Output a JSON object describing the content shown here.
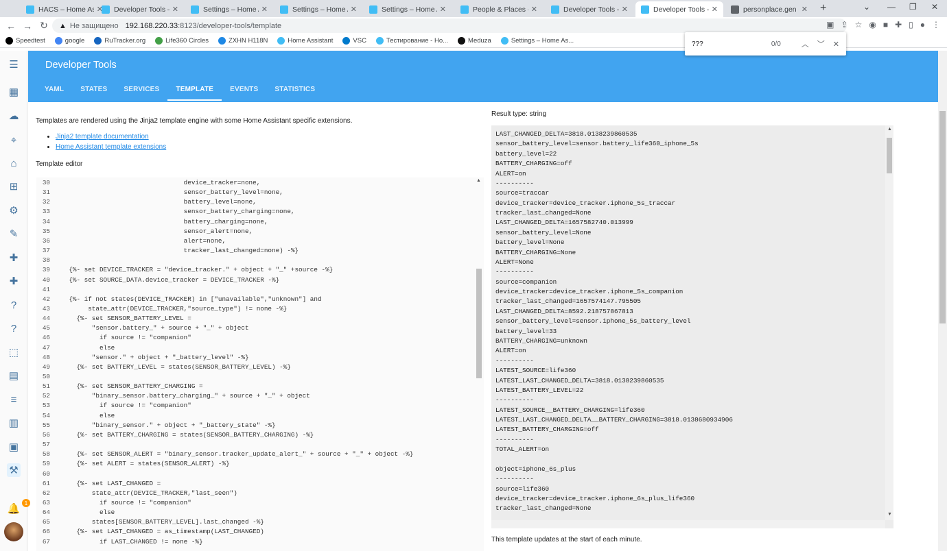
{
  "browser": {
    "tabs": [
      {
        "title": "HACS – Home Assistant",
        "active": false
      },
      {
        "title": "Developer Tools – Home",
        "active": false
      },
      {
        "title": "Settings – Home Assist",
        "active": false
      },
      {
        "title": "Settings – Home Assist",
        "active": false
      },
      {
        "title": "Settings – Home Assist",
        "active": false
      },
      {
        "title": "People & Places – Hom",
        "active": false
      },
      {
        "title": "Developer Tools – Hom",
        "active": false
      },
      {
        "title": "Developer Tools – Hom",
        "active": true
      },
      {
        "title": "personplace.gen - wor",
        "active": false
      }
    ],
    "insecure_label": "Не защищено",
    "url_host": "192.168.220.33",
    "url_path": ":8123/developer-tools/template",
    "bookmarks": [
      "Speedtest",
      "google",
      "RuTracker.org",
      "Life360 Circles",
      "ZXHN H118N",
      "Home Assistant",
      "VSC",
      "Тестирование - Но...",
      "Meduza",
      "Settings – Home As..."
    ],
    "find": {
      "query": "???",
      "count": "0/0"
    }
  },
  "header": {
    "title": "Developer Tools",
    "tabs": [
      "YAML",
      "STATES",
      "SERVICES",
      "TEMPLATE",
      "EVENTS",
      "STATISTICS"
    ],
    "selected_tab": "TEMPLATE"
  },
  "sidebar": {
    "notification_count": "1"
  },
  "main": {
    "intro": "Templates are rendered using the Jinja2 template engine with some Home Assistant specific extensions.",
    "links": [
      "Jinja2 template documentation",
      "Home Assistant template extensions"
    ],
    "editor_label": "Template editor",
    "result_type": "Result type: string",
    "footer": "This template updates at the start of each minute."
  },
  "editor_lines": [
    {
      "n": "30",
      "t": "                                  device_tracker=none,"
    },
    {
      "n": "31",
      "t": "                                  sensor_battery_level=none,"
    },
    {
      "n": "32",
      "t": "                                  battery_level=none,"
    },
    {
      "n": "33",
      "t": "                                  sensor_battery_charging=none,"
    },
    {
      "n": "34",
      "t": "                                  battery_charging=none,"
    },
    {
      "n": "35",
      "t": "                                  sensor_alert=none,"
    },
    {
      "n": "36",
      "t": "                                  alert=none,"
    },
    {
      "n": "37",
      "t": "                                  tracker_last_changed=none) -%}"
    },
    {
      "n": "38",
      "t": ""
    },
    {
      "n": "39",
      "t": "    {%- set DEVICE_TRACKER = \"device_tracker.\" + object + \"_\" +source -%}"
    },
    {
      "n": "40",
      "t": "    {%- set SOURCE_DATA.device_tracker = DEVICE_TRACKER -%}"
    },
    {
      "n": "41",
      "t": ""
    },
    {
      "n": "42",
      "t": "    {%- if not states(DEVICE_TRACKER) in [\"unavailable\",\"unknown\"] and"
    },
    {
      "n": "43",
      "t": "         state_attr(DEVICE_TRACKER,\"source_type\") != none -%}"
    },
    {
      "n": "44",
      "t": "      {%- set SENSOR_BATTERY_LEVEL ="
    },
    {
      "n": "45",
      "t": "          \"sensor.battery_\" + source + \"_\" + object"
    },
    {
      "n": "46",
      "t": "            if source != \"companion\""
    },
    {
      "n": "47",
      "t": "            else"
    },
    {
      "n": "48",
      "t": "          \"sensor.\" + object + \"_battery_level\" -%}"
    },
    {
      "n": "49",
      "t": "      {%- set BATTERY_LEVEL = states(SENSOR_BATTERY_LEVEL) -%}"
    },
    {
      "n": "50",
      "t": ""
    },
    {
      "n": "51",
      "t": "      {%- set SENSOR_BATTERY_CHARGING ="
    },
    {
      "n": "52",
      "t": "          \"binary_sensor.battery_charging_\" + source + \"_\" + object"
    },
    {
      "n": "53",
      "t": "            if source != \"companion\""
    },
    {
      "n": "54",
      "t": "            else"
    },
    {
      "n": "55",
      "t": "          \"binary_sensor.\" + object + \"_battery_state\" -%}"
    },
    {
      "n": "56",
      "t": "      {%- set BATTERY_CHARGING = states(SENSOR_BATTERY_CHARGING) -%}"
    },
    {
      "n": "57",
      "t": ""
    },
    {
      "n": "58",
      "t": "      {%- set SENSOR_ALERT = \"binary_sensor.tracker_update_alert_\" + source + \"_\" + object -%}"
    },
    {
      "n": "59",
      "t": "      {%- set ALERT = states(SENSOR_ALERT) -%}"
    },
    {
      "n": "60",
      "t": ""
    },
    {
      "n": "61",
      "t": "      {%- set LAST_CHANGED ="
    },
    {
      "n": "62",
      "t": "          state_attr(DEVICE_TRACKER,\"last_seen\")"
    },
    {
      "n": "63",
      "t": "            if source != \"companion\""
    },
    {
      "n": "64",
      "t": "            else"
    },
    {
      "n": "65",
      "t": "          states[SENSOR_BATTERY_LEVEL].last_changed -%}"
    },
    {
      "n": "66",
      "t": "      {%- set LAST_CHANGED = as_timestamp(LAST_CHANGED)"
    },
    {
      "n": "67",
      "t": "            if LAST_CHANGED != none -%}"
    }
  ],
  "result_lines": [
    "LAST_CHANGED_DELTA=3818.0138239860535",
    "sensor_battery_level=sensor.battery_life360_iphone_5s",
    "battery_level=22",
    "BATTERY_CHARGING=off",
    "ALERT=on",
    "----------",
    "source=traccar",
    "device_tracker=device_tracker.iphone_5s_traccar",
    "tracker_last_changed=None",
    "LAST_CHANGED_DELTA=1657582740.013999",
    "sensor_battery_level=None",
    "battery_level=None",
    "BATTERY_CHARGING=None",
    "ALERT=None",
    "----------",
    "source=companion",
    "device_tracker=device_tracker.iphone_5s_companion",
    "tracker_last_changed=1657574147.795505",
    "LAST_CHANGED_DELTA=8592.218757867813",
    "sensor_battery_level=sensor.iphone_5s_battery_level",
    "battery_level=33",
    "BATTERY_CHARGING=unknown",
    "ALERT=on",
    "----------",
    "LATEST_SOURCE=life360",
    "LATEST_LAST_CHANGED_DELTA=3818.0138239860535",
    "LATEST_BATTERY_LEVEL=22",
    "----------",
    "LATEST_SOURCE__BATTERY_CHARGING=life360",
    "LATEST_LAST_CHANGED_DELTA__BATTERY_CHARGING=3818.0138680934906",
    "LATEST_BATTERY_CHARGING=off",
    "----------",
    "TOTAL_ALERT=on",
    "",
    "object=iphone_6s_plus",
    "----------",
    "source=life360",
    "device_tracker=device_tracker.iphone_6s_plus_life360",
    "tracker_last_changed=None"
  ]
}
